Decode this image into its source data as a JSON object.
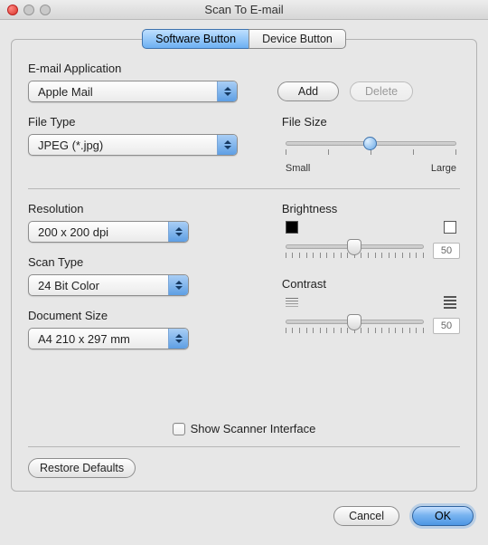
{
  "window": {
    "title": "Scan To E-mail"
  },
  "tabs": {
    "software": "Software Button",
    "device": "Device Button",
    "active": "software"
  },
  "email": {
    "label": "E-mail Application",
    "value": "Apple Mail",
    "add": "Add",
    "delete": "Delete"
  },
  "filetype": {
    "label": "File Type",
    "value": "JPEG (*.jpg)"
  },
  "filesize": {
    "label": "File Size",
    "min": "Small",
    "max": "Large",
    "percent": 50
  },
  "resolution": {
    "label": "Resolution",
    "value": "200 x 200 dpi"
  },
  "scantype": {
    "label": "Scan Type",
    "value": "24 Bit Color"
  },
  "docsize": {
    "label": "Document Size",
    "value": "A4  210 x 297 mm"
  },
  "brightness": {
    "label": "Brightness",
    "value": 50
  },
  "contrast": {
    "label": "Contrast",
    "value": 50
  },
  "show_scanner": {
    "label": "Show Scanner Interface",
    "checked": false
  },
  "restore": "Restore Defaults",
  "cancel": "Cancel",
  "ok": "OK"
}
